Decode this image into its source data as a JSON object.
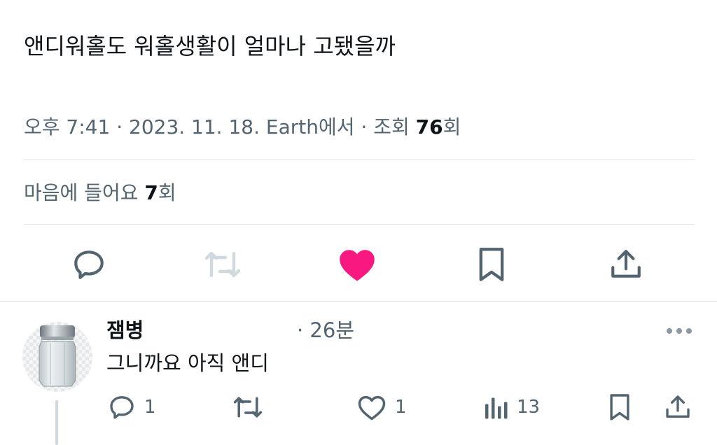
{
  "tweet": {
    "text": "앤디워홀도 워홀생활이 얼마나 고됐을까",
    "meta_prefix": "오후 7:41 · 2023. 11. 18. Earth에서 · 조회 ",
    "views": "76",
    "views_suffix": "회",
    "likes_prefix": "마음에 들어요 ",
    "likes": "7",
    "likes_suffix": "회"
  },
  "actions": {
    "icons": [
      "reply-icon",
      "retweet-icon",
      "heart-icon",
      "bookmark-icon",
      "share-icon"
    ],
    "heart_color": "#f91880",
    "retweet_disabled_color": "#cfd9de",
    "icon_color": "#536471"
  },
  "reply": {
    "name": "잼병",
    "time": "· 26분",
    "text": "그니까요 아직 앤디",
    "reply_count": "1",
    "like_count": "1",
    "view_count": "13",
    "avatar_icon": "jar-avatar"
  }
}
